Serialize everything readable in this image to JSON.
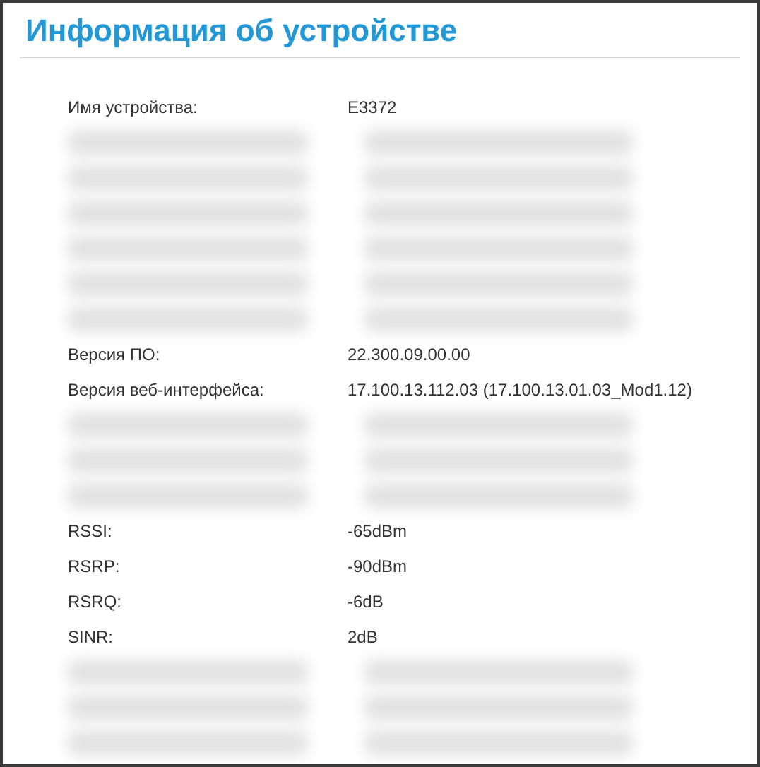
{
  "title": "Информация об устройстве",
  "rows": [
    {
      "kind": "field",
      "label": "Имя устройства:",
      "value": "E3372"
    },
    {
      "kind": "redacted"
    },
    {
      "kind": "redacted"
    },
    {
      "kind": "redacted"
    },
    {
      "kind": "redacted"
    },
    {
      "kind": "redacted"
    },
    {
      "kind": "redacted"
    },
    {
      "kind": "field",
      "label": "Версия ПО:",
      "value": "22.300.09.00.00"
    },
    {
      "kind": "field",
      "label": "Версия веб-интерфейса:",
      "value": "17.100.13.112.03 (17.100.13.01.03_Mod1.12)"
    },
    {
      "kind": "redacted"
    },
    {
      "kind": "redacted"
    },
    {
      "kind": "redacted"
    },
    {
      "kind": "field",
      "label": "RSSI:",
      "value": "-65dBm"
    },
    {
      "kind": "field",
      "label": "RSRP:",
      "value": "-90dBm"
    },
    {
      "kind": "field",
      "label": "RSRQ:",
      "value": "-6dB"
    },
    {
      "kind": "field",
      "label": "SINR:",
      "value": "2dB"
    },
    {
      "kind": "redacted"
    },
    {
      "kind": "redacted"
    },
    {
      "kind": "redacted"
    }
  ]
}
